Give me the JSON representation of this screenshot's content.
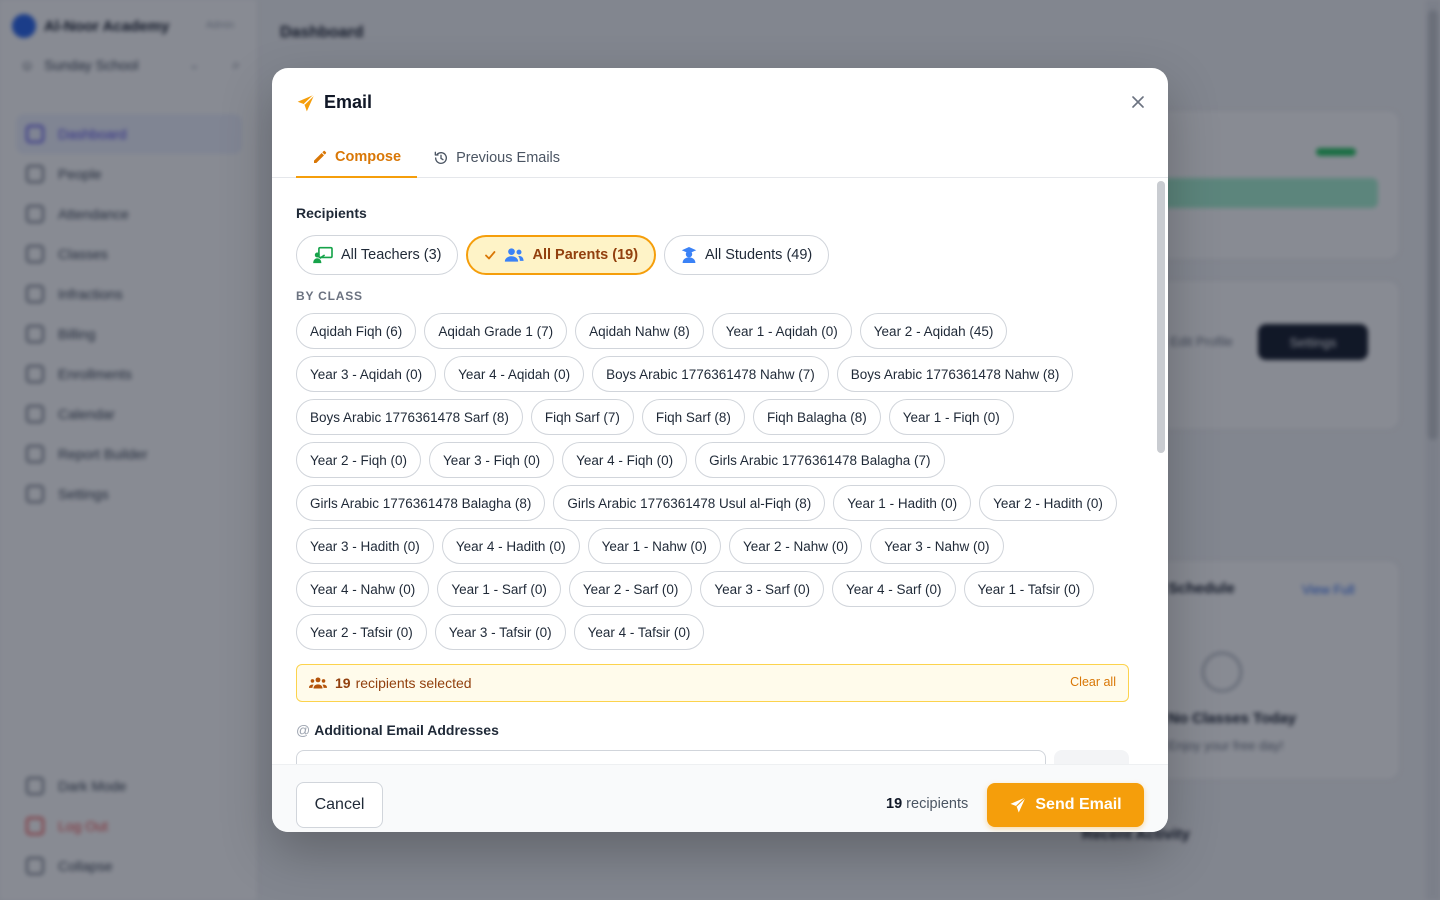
{
  "background": {
    "brand": "Al-Noor Academy",
    "brand_badge": "Admin",
    "school": "Sunday School",
    "nav": [
      "Dashboard",
      "People",
      "Attendance",
      "Classes",
      "Infractions",
      "Billing",
      "Enrollments",
      "Calendar",
      "Report Builder",
      "Settings"
    ],
    "bottom_nav": [
      "Dark Mode",
      "Log Out",
      "Collapse"
    ],
    "page_title": "Dashboard",
    "settings_button": "Settings",
    "profile_text": "Edit Profile",
    "schedule_title": "Schedule",
    "view_full": "View Full",
    "no_classes": "No Classes Today",
    "enjoy": "Enjoy your free day!",
    "recent_activity": "Recent Activity"
  },
  "modal": {
    "title": "Email",
    "tabs": [
      {
        "label": "Compose",
        "icon": "pencil-icon",
        "active": true
      },
      {
        "label": "Previous Emails",
        "icon": "history-icon",
        "active": false
      }
    ],
    "recipients_label": "Recipients",
    "groups": [
      {
        "label": "All Teachers (3)",
        "icon": "teacher-icon",
        "selected": false
      },
      {
        "label": "All Parents (19)",
        "icon": "users-icon",
        "selected": true
      },
      {
        "label": "All Students (49)",
        "icon": "student-icon",
        "selected": false
      }
    ],
    "by_class_label": "BY CLASS",
    "classes": [
      "Aqidah Fiqh (6)",
      "Aqidah Grade 1 (7)",
      "Aqidah Nahw (8)",
      "Year 1 - Aqidah (0)",
      "Year 2 - Aqidah (45)",
      "Year 3 - Aqidah (0)",
      "Year 4 - Aqidah (0)",
      "Boys Arabic 1776361478 Nahw (7)",
      "Boys Arabic 1776361478 Nahw (8)",
      "Boys Arabic 1776361478 Sarf (8)",
      "Fiqh Sarf (7)",
      "Fiqh Sarf (8)",
      "Fiqh Balagha (8)",
      "Year 1 - Fiqh (0)",
      "Year 2 - Fiqh (0)",
      "Year 3 - Fiqh (0)",
      "Year 4 - Fiqh (0)",
      "Girls Arabic 1776361478 Balagha (7)",
      "Girls Arabic 1776361478 Balagha (8)",
      "Girls Arabic 1776361478 Usul al-Fiqh (8)",
      "Year 1 - Hadith (0)",
      "Year 2 - Hadith (0)",
      "Year 3 - Hadith (0)",
      "Year 4 - Hadith (0)",
      "Year 1 - Nahw (0)",
      "Year 2 - Nahw (0)",
      "Year 3 - Nahw (0)",
      "Year 4 - Nahw (0)",
      "Year 1 - Sarf (0)",
      "Year 2 - Sarf (0)",
      "Year 3 - Sarf (0)",
      "Year 4 - Sarf (0)",
      "Year 1 - Tafsir (0)",
      "Year 2 - Tafsir (0)",
      "Year 3 - Tafsir (0)",
      "Year 4 - Tafsir (0)"
    ],
    "selected_count": "19",
    "selected_text": "recipients selected",
    "clear_all": "Clear all",
    "additional_label": "Additional Email Addresses",
    "footer": {
      "cancel": "Cancel",
      "count": "19",
      "count_text": "recipients",
      "send": "Send Email"
    }
  },
  "colors": {
    "accent": "#f59e0b",
    "accent_dark": "#d97706",
    "selected_bg": "#fef3c7"
  }
}
